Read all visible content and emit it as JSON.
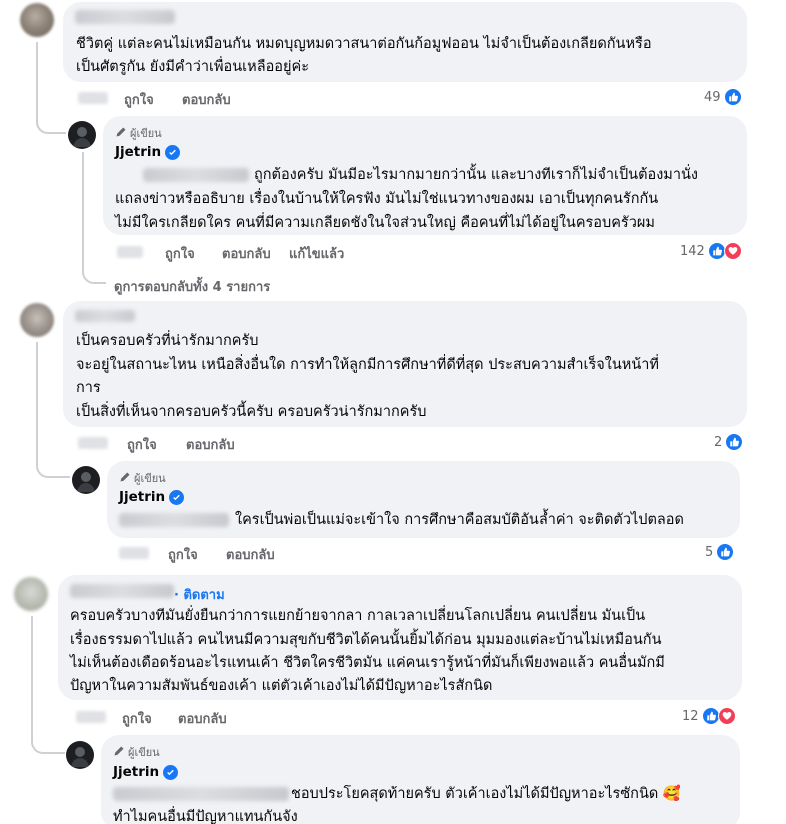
{
  "colors": {
    "accent": "#1877f2",
    "love": "#f33e58",
    "bubble": "#f0f2f5",
    "muted": "#65676b"
  },
  "actions": {
    "like": "ถูกใจ",
    "reply": "ตอบกลับ",
    "edited": "แก้ไขแล้ว"
  },
  "author_badge": "ผู้เขียน",
  "follow_label": "· ติดตาม",
  "comments": [
    {
      "text": [
        "ชีวิตคู่ แต่ละคนไม่เหมือนกัน หมดบุญหมดวาสนาต่อกันก้อมูฟออน ไม่จำเป็นต้องเกลียดกันหรือ",
        "เป็นศัตรูกัน ยังมีคำว่าเพื่อนเหลืออยู่ค่ะ"
      ],
      "reaction_count": "49",
      "reply": {
        "username": "Jjetrin",
        "text": [
          "ถูกต้องครับ มันมีอะไรมากมายกว่านั้น และบางทีเราก็ไม่จำเป็นต้องมานั่ง",
          "แถลงข่าวหรืออธิบาย เรื่องในบ้านให้ใครฟัง มันไม่ใช่แนวทางของผม เอาเป็นทุกคนรักกัน",
          "ไม่มีใครเกลียดใคร คนที่มีความเกลียดชังในใจส่วนใหญ่ คือคนที่ไม่ได้อยู่ในครอบครัวผม"
        ],
        "reaction_count": "142"
      },
      "view_replies": "ดูการตอบกลับทั้ง 4 รายการ"
    },
    {
      "text": [
        "เป็นครอบครัวที่น่ารักมากครับ",
        "จะอยู่ในสถานะไหน เหนือสิ่งอื่นใด การทำให้ลูกมีการศึกษาที่ดีที่สุด ประสบความสำเร็จในหน้าที่",
        "การ",
        "เป็นสิ่งที่เห็นจากครอบครัวนี้ครับ ครอบครัวน่ารักมากครับ"
      ],
      "reaction_count": "2",
      "reply": {
        "username": "Jjetrin",
        "text": [
          "ใครเป็นพ่อเป็นแม่จะเข้าใจ การศึกษาคือสมบัติอันล้ำค่า จะติดตัวไปตลอด"
        ],
        "reaction_count": "5"
      }
    },
    {
      "text": [
        "ครอบครัวบางทีมันยั่งยืนกว่าการแยกย้ายจากลา กาลเวลาเปลี่ยนโลกเปลี่ยน คนเปลี่ยน มันเป็น",
        "เรื่องธรรมดาไปแล้ว คนไหนมีความสุขกับชีวิตได้คนนั้นยิ้มได้ก่อน มุมมองแต่ละบ้านไม่เหมือนกัน",
        "ไม่เห็นต้องเดือดร้อนอะไรแทนเค้า ชีวิตใครชีวิตมัน แค่คนเรารู้หน้าที่มันก็เพียงพอแล้ว คนอื่นมักมี",
        "ปัญหาในความสัมพันธ์ของเค้า แต่ตัวเค้าเองไม่ได้มีปัญหาอะไรสักนิด"
      ],
      "reaction_count": "12",
      "reply": {
        "username": "Jjetrin",
        "text": [
          "ชอบประโยคสุดท้ายครับ ตัวเค้าเองไม่ได้มีปัญหาอะไรซักนิด 🥰",
          "ทำไมคนอื่นมีปัญหาแทนกันจัง"
        ]
      }
    }
  ]
}
